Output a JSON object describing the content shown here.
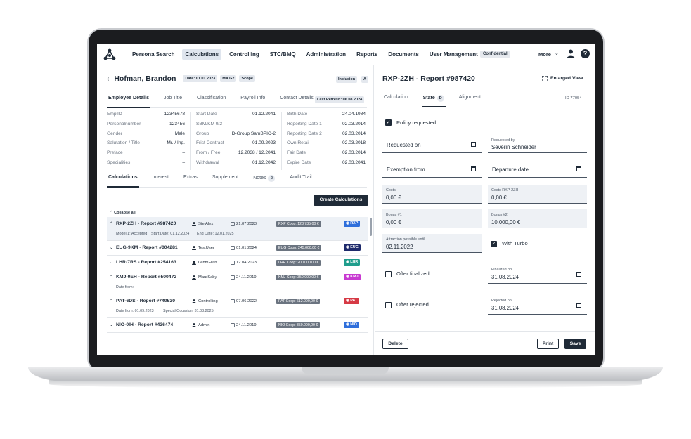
{
  "nav": {
    "items": [
      "Persona Search",
      "Calculations",
      "Controlling",
      "STC/BMQ",
      "Administration",
      "Reports",
      "Documents",
      "User Management"
    ],
    "active_index": 1,
    "confidential": "Confidential",
    "more": "More"
  },
  "person": {
    "name": "Hofman, Brandon",
    "chip_date": "Date: 01.01.2023",
    "chip_ma": "MA G2",
    "chip_scope": "Scope",
    "dots": "···",
    "inclusion": "Inclusion",
    "inclusion_flag": "A"
  },
  "detail_tabs": [
    "Employee Details",
    "Job Title",
    "Classification",
    "Payroll Info",
    "Contact Details"
  ],
  "last_refresh": "Last Refresh: 06.08.2024",
  "details": {
    "col1": [
      {
        "k": "EmplID",
        "v": "12345678"
      },
      {
        "k": "Personalnumber",
        "v": "123456"
      },
      {
        "k": "Gender",
        "v": "Male"
      },
      {
        "k": "Salutation / Title",
        "v": "Mr. / Ing."
      },
      {
        "k": "Preface",
        "v": "–"
      },
      {
        "k": "Specialities",
        "v": "–"
      }
    ],
    "col2": [
      {
        "k": "Start Date",
        "v": "01.12.2041"
      },
      {
        "k": "SBM/KM 9/2",
        "v": "–"
      },
      {
        "k": "Group",
        "v": "D-Group SamBPIO-2"
      },
      {
        "k": "Frist Contract",
        "v": "01.09.2023"
      },
      {
        "k": "From / Free",
        "v": "12.2038 / 12.2041"
      },
      {
        "k": "Withdrawal",
        "v": "01.12.2042"
      }
    ],
    "col3": [
      {
        "k": "Birth Date",
        "v": "24.04.1984"
      },
      {
        "k": "Reporting Date 1",
        "v": "02.03.2014"
      },
      {
        "k": "Reporting Date 2",
        "v": "02.03.2014"
      },
      {
        "k": "Own Retail",
        "v": "02.03.2018"
      },
      {
        "k": "Fair Date",
        "v": "02.03.2014"
      },
      {
        "k": "Expire Date",
        "v": "02.03.2041"
      }
    ]
  },
  "calc_tabs": {
    "calculations": "Calculations",
    "interest": "Interest",
    "extras": "Extras",
    "supplement": "Supplement",
    "notes": "Notes",
    "notes_count": "2",
    "audit": "Audit Trail"
  },
  "create_button": "Create Calculations",
  "collapse_all": "Collapse all",
  "reports": [
    {
      "title": "RXP-2ZH - Report #987420",
      "user": "SteiAlex",
      "date": "21.07.2023",
      "coop": "RXP Coop: 128.735,00 €",
      "tag": "RXP",
      "color": "#2f6fdb",
      "chev": "^",
      "sub": [
        "Model 1: Accepted",
        "Start Date: 01.12.2024",
        "End Date: 12.01.2025"
      ]
    },
    {
      "title": "EUG-9KM - Report #004281",
      "user": "TestUser",
      "date": "01.01.2024",
      "coop": "EUG Coop: 245.000,00 €",
      "tag": "EUG",
      "color": "#1e2a6b",
      "chev": "v",
      "sub": []
    },
    {
      "title": "LHR-7RS - Report #254163",
      "user": "LehmFran",
      "date": "12.04.2023",
      "coop": "LHR Coop: 200.000,00 €",
      "tag": "LHR",
      "color": "#1f9d8c",
      "chev": "v",
      "sub": []
    },
    {
      "title": "KMJ-0EH - Report #500472",
      "user": "MaurSaby",
      "date": "24.11.2019",
      "coop": "KMJ Coop: 350.000,00 €",
      "tag": "KMJ",
      "color": "#c83ad1",
      "chev": "^",
      "sub": [
        "Date from: –"
      ]
    },
    {
      "title": "PAT-6DS - Report #749530",
      "user": "Controlling",
      "date": "07.06.2022",
      "coop": "PAT Coop: 612.000,00 €",
      "tag": "PAT",
      "color": "#d63a45",
      "chev": "^",
      "sub": [
        "Date from: 01.09.2023",
        "Special Occasion: 31.08.2025"
      ]
    },
    {
      "title": "NIO-0IH - Report #436474",
      "user": "Admin",
      "date": "24.11.2019",
      "coop": "NIO Coop: 350.000,00 €",
      "tag": "NIO",
      "color": "#2f6fdb",
      "chev": "v",
      "sub": []
    }
  ],
  "right": {
    "title": "RXP-2ZH - Report #987420",
    "enlarged": "Enlarged View",
    "tabs": [
      "Calculation",
      "State",
      "Alignment"
    ],
    "state_badge": "D",
    "id": "ID 77054",
    "policy_requested": "Policy requested",
    "requested_on": "Requested on",
    "requested_by_label": "Requested by",
    "requested_by": "Severin Schneider",
    "exemption_from": "Exemption from",
    "departure_date": "Departure date",
    "costs_label": "Costs",
    "costs": "0,00 €",
    "costs_rxp_label": "Costs RXP-2ZH",
    "costs_rxp": "0,00 €",
    "bonus1_label": "Bonus #1",
    "bonus1": "0,00 €",
    "bonus2_label": "Bonus #2",
    "bonus2": "10.000,00 €",
    "attraction_label": "Attraction possible until",
    "attraction": "02.11.2022",
    "with_turbo": "With Turbo",
    "offer_finalized": "Offer finalized",
    "finalized_on_label": "Finalized on",
    "finalized_on": "31.08.2024",
    "offer_rejected": "Offer rejected",
    "rejected_on_label": "Rejected on",
    "rejected_on": "31.08.2024",
    "delete": "Delete",
    "print": "Print",
    "save": "Save"
  }
}
